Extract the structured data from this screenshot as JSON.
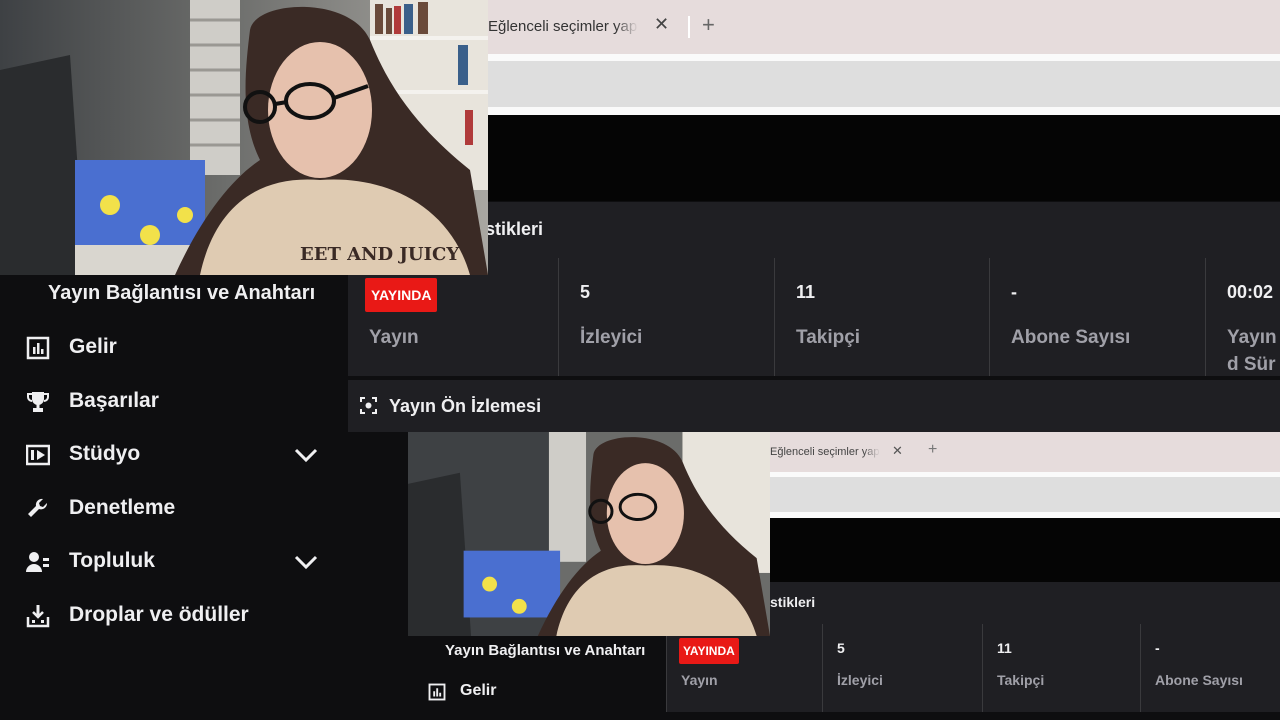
{
  "browser": {
    "tab_title": "Eğlenceli seçimler yap",
    "tab_close": "✕",
    "new_tab": "+"
  },
  "stats": {
    "title_fragment": "stikleri",
    "live_badge": "YAYINDA",
    "items": [
      {
        "value": "",
        "label": "Yayın"
      },
      {
        "value": "5",
        "label": "İzleyici"
      },
      {
        "value": "11",
        "label": "Takipçi"
      },
      {
        "value": "-",
        "label": "Abone Sayısı"
      },
      {
        "value": "00:02",
        "label": "Yayınd Süre"
      }
    ]
  },
  "preview": {
    "title": "Yayın Ön İzlemesi"
  },
  "sidebar": {
    "heading": "Yayın Bağlantısı ve Anahtarı",
    "items": [
      {
        "label": "Gelir",
        "icon": "bar-chart-icon"
      },
      {
        "label": "Başarılar",
        "icon": "trophy-icon"
      },
      {
        "label": "Stüdyo",
        "icon": "studio-icon",
        "expandable": true
      },
      {
        "label": "Denetleme",
        "icon": "wrench-icon"
      },
      {
        "label": "Topluluk",
        "icon": "community-icon",
        "expandable": true
      },
      {
        "label": "Droplar ve ödüller",
        "icon": "drops-icon"
      }
    ]
  },
  "nested": {
    "tab_title": "Eğlenceli seçimler yap",
    "stats_title_fragment": "stikleri",
    "live_badge": "YAYINDA",
    "items": [
      {
        "value": "",
        "label": "Yayın"
      },
      {
        "value": "5",
        "label": "İzleyici"
      },
      {
        "value": "11",
        "label": "Takipçi"
      },
      {
        "value": "-",
        "label": "Abone Sayısı"
      }
    ],
    "sidebar_heading": "Yayın Bağlantısı ve Anahtarı",
    "sidebar_item": "Gelir"
  },
  "colors": {
    "live_red": "#e91916",
    "panel": "#1f1f23",
    "background": "#0e0e10",
    "muted_text": "#a0a0a8"
  }
}
